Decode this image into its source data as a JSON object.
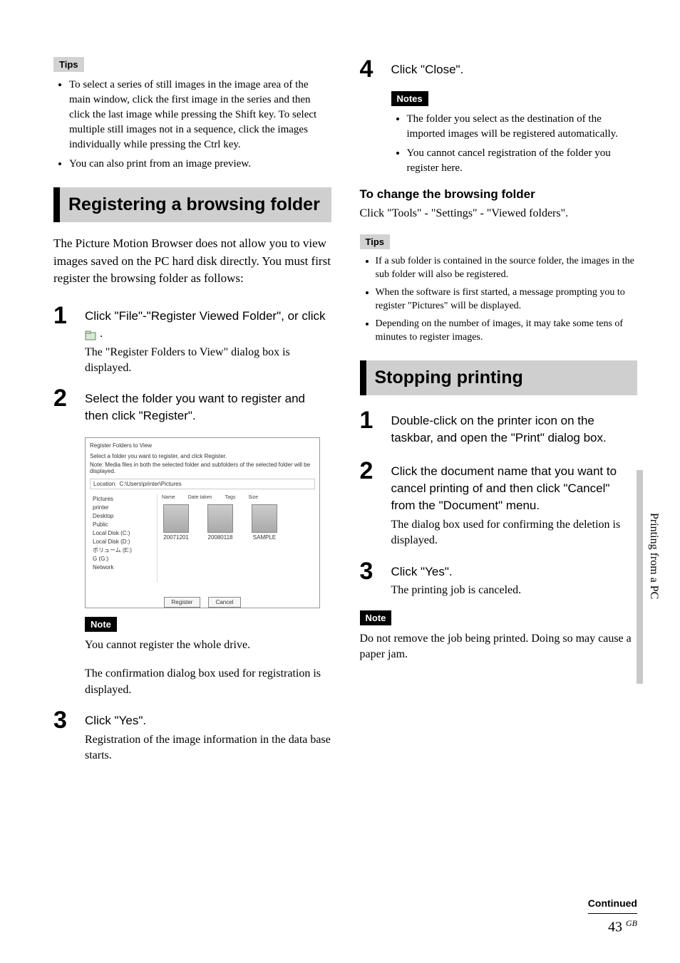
{
  "left": {
    "tips_label": "Tips",
    "tips": [
      "To select a series of still images in the image area of the main window, click the first image in the series and then click the last image while pressing the Shift key. To select multiple still images not in a sequence, click the images individually while pressing the Ctrl key.",
      "You can also print from an image preview."
    ],
    "section_heading": "Registering a browsing folder",
    "intro": "The Picture Motion Browser does not allow you to view images saved on the PC hard disk directly. You must first register the browsing folder as follows:",
    "step1_num": "1",
    "step1_action_a": "Click \"File\"-\"Register Viewed Folder\", or click ",
    "step1_action_b": " .",
    "step1_icon": "register-viewed-folder-icon",
    "step1_desc": "The \"Register Folders to View\" dialog box is displayed.",
    "step2_num": "2",
    "step2_action": "Select the folder you want to register and then click \"Register\".",
    "screenshot": {
      "title": "Register Folders to View",
      "instr1": "Select a folder you want to register, and click Register.",
      "instr2": "Note: Media files in both the selected folder and subfolders of the selected folder will be displayed.",
      "location_label": "Location:",
      "location_path": "C:\\Users\\printer\\Pictures",
      "tree": [
        "Pictures",
        "printer",
        "Desktop",
        "Public",
        "Local Disk (C:)",
        "Local Disk (D:)",
        "ボリューム (E:)",
        "G (G:)",
        "Network"
      ],
      "cols": [
        "Name",
        "Date taken",
        "Tags",
        "Size"
      ],
      "thumbs": [
        "20071201",
        "20080118",
        "SAMPLE"
      ],
      "btn_register": "Register",
      "btn_cancel": "Cancel"
    },
    "note_label": "Note",
    "note_text": "You cannot register the whole drive.",
    "confirm_text": "The confirmation dialog box used for registration is displayed.",
    "step3_num": "3",
    "step3_action": "Click \"Yes\".",
    "step3_desc": "Registration of the image information in the data base starts."
  },
  "right": {
    "step4_num": "4",
    "step4_action": "Click \"Close\".",
    "notes_label": "Notes",
    "notes": [
      "The folder you select as the destination of the imported images will be registered automatically.",
      "You cannot cancel registration of the folder you register here."
    ],
    "subheading": "To change the browsing folder",
    "subheading_desc": "Click \"Tools\" - \"Settings\" - \"Viewed folders\".",
    "tips_label": "Tips",
    "tips": [
      "If a sub folder is contained in the source folder, the images in the sub folder will also be registered.",
      "When the software is first started, a message prompting you to register \"Pictures\" will be displayed.",
      "Depending on the number of images, it may take some tens of minutes to register images."
    ],
    "section_heading": "Stopping printing",
    "step1_num": "1",
    "step1_action": "Double-click on the printer icon on the taskbar, and open the \"Print\" dialog box.",
    "step2_num": "2",
    "step2_action": "Click the document name that you want to cancel printing of and then click \"Cancel\" from the \"Document\" menu.",
    "step2_desc": "The dialog box used for confirming the deletion is displayed.",
    "step3_num": "3",
    "step3_action": "Click \"Yes\".",
    "step3_desc": "The printing job is canceled.",
    "note_label": "Note",
    "note_text": "Do not remove the job being printed. Doing so may cause a paper jam."
  },
  "side_label": "Printing from a PC",
  "footer": {
    "continued": "Continued",
    "page_num": "43",
    "gb": "GB"
  }
}
